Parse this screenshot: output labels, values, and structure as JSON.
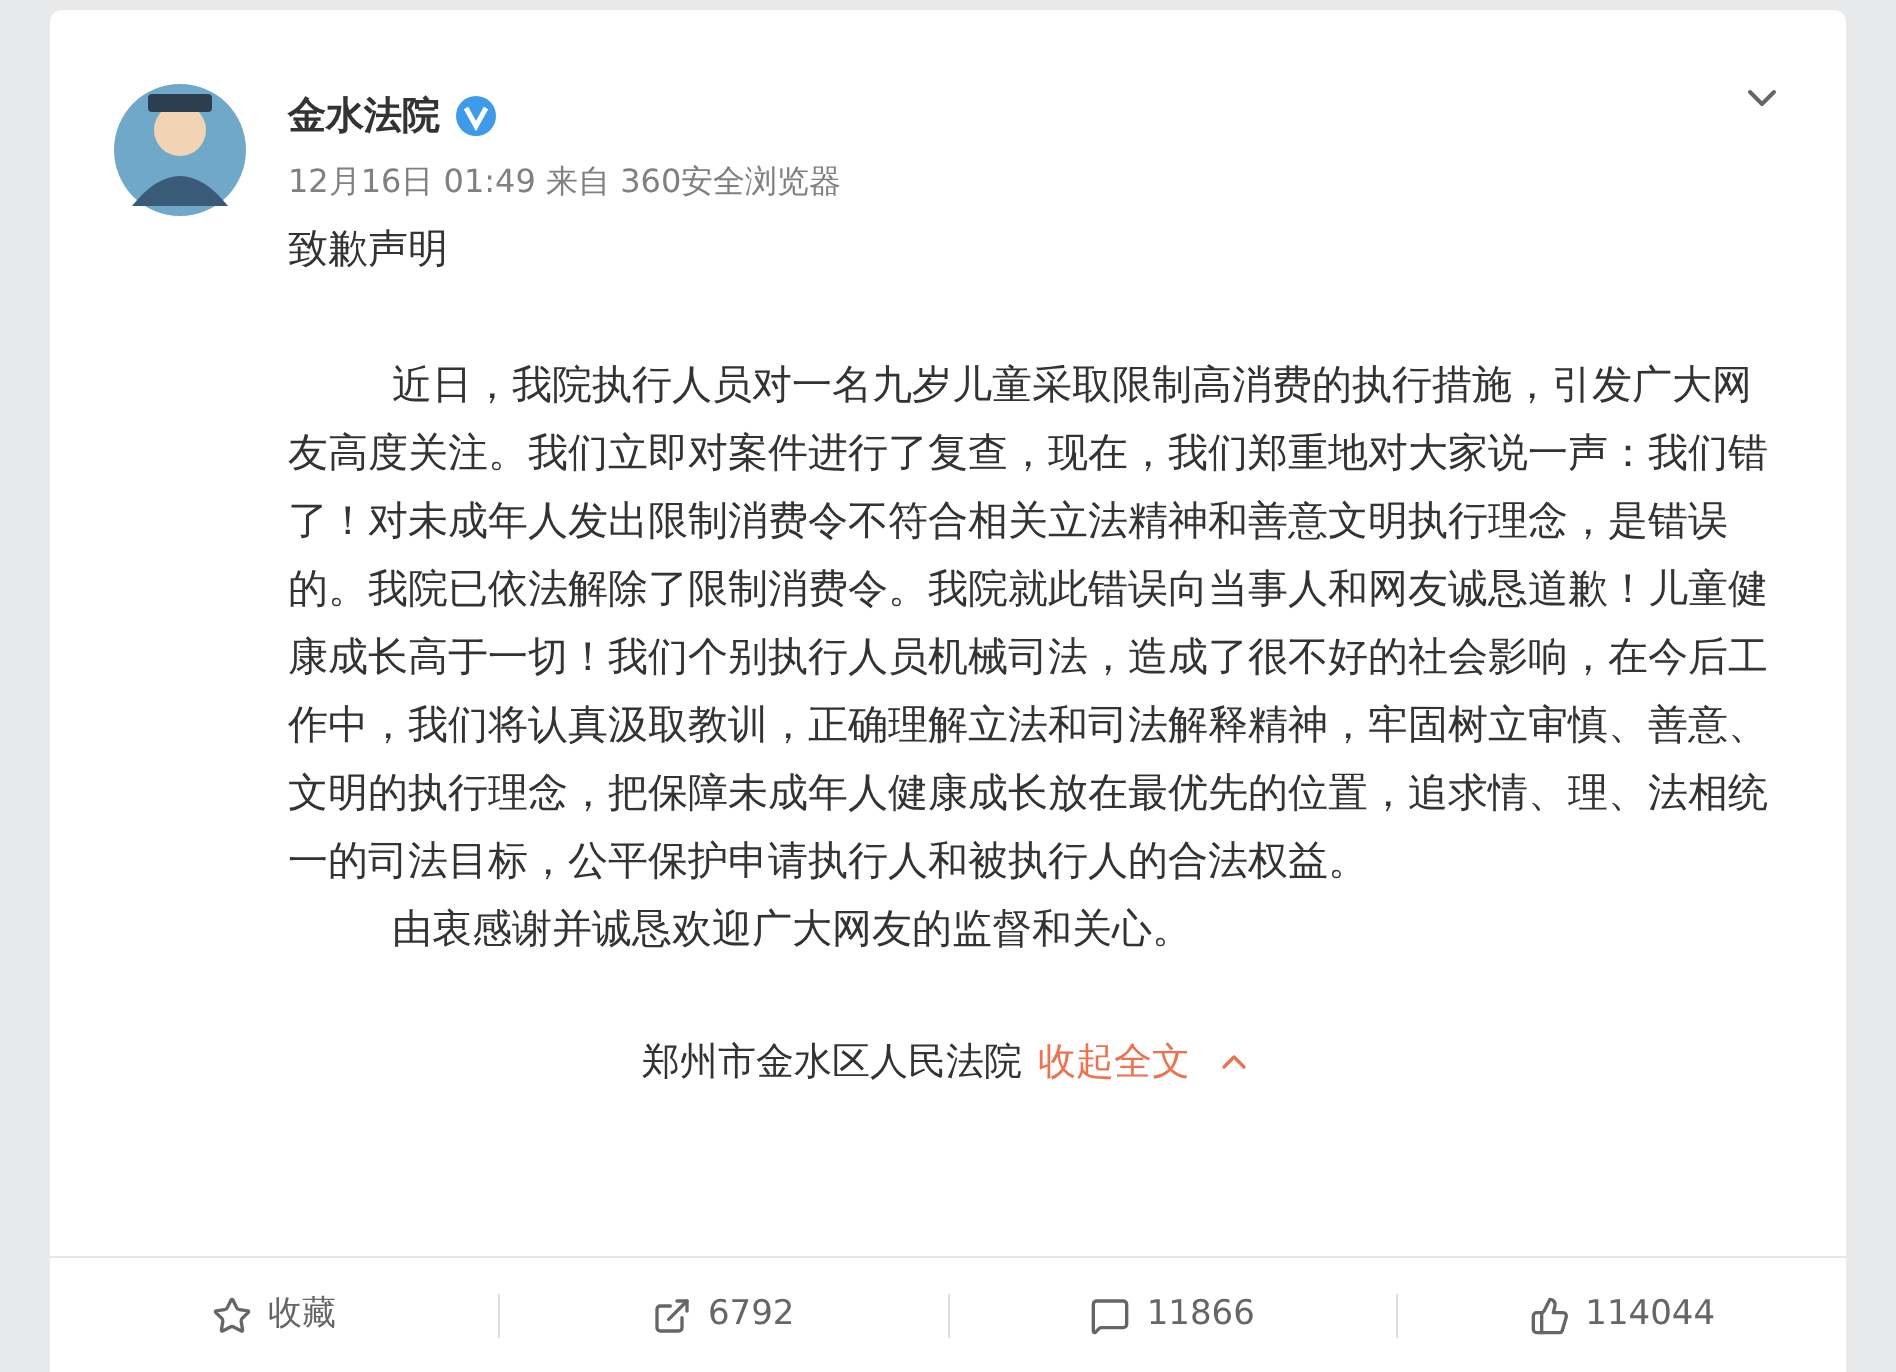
{
  "post": {
    "author": "金水法院",
    "verified": true,
    "meta": "12月16日 01:49 来自 360安全浏览器",
    "title": "致歉声明",
    "paragraphs": [
      "近日，我院执行人员对一名九岁儿童采取限制高消费的执行措施，引发广大网友高度关注。我们立即对案件进行了复查，现在，我们郑重地对大家说一声：我们错了！对未成年人发出限制消费令不符合相关立法精神和善意文明执行理念，是错误的。我院已依法解除了限制消费令。我院就此错误向当事人和网友诚恳道歉！儿童健康成长高于一切！我们个别执行人员机械司法，造成了很不好的社会影响，在今后工作中，我们将认真汲取教训，正确理解立法和司法解释精神，牢固树立审慎、善意、文明的执行理念，把保障未成年人健康成长放在最优先的位置，追求情、理、法相统一的司法目标，公平保护申请执行人和被执行人的合法权益。",
      "由衷感谢并诚恳欢迎广大网友的监督和关心。"
    ],
    "signature": "郑州市金水区人民法院",
    "collapse": "收起全文"
  },
  "actions": [
    {
      "kind": "favorite",
      "label": "收藏"
    },
    {
      "kind": "repost",
      "label": "6792"
    },
    {
      "kind": "comment",
      "label": "11866"
    },
    {
      "kind": "like",
      "label": "114044"
    }
  ]
}
